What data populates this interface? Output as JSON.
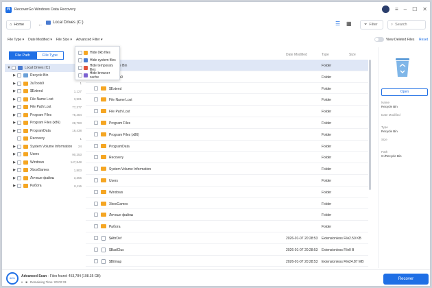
{
  "app": {
    "title": "RecoverGo Windows Data Recovery",
    "logo": "R"
  },
  "window_controls": {
    "settings": "≡",
    "minimize": "–",
    "maximize": "☐",
    "close": "✕"
  },
  "nav": {
    "home_label": "Home",
    "breadcrumb": "Local Drives (C:)",
    "filter_label": "Filter",
    "search_placeholder": "Search"
  },
  "filter_bar": {
    "file_type": "File Type",
    "date_modified": "Date Modified",
    "file_size": "File Size",
    "advanced_filter": "Advanced Filter",
    "view_deleted": "View Deleted Files",
    "reset": "Reset"
  },
  "advanced_menu": [
    {
      "label": "Hide 0kb files",
      "icon_color": "#f5a623"
    },
    {
      "label": "Hide system files",
      "icon_color": "#4a7bd0"
    },
    {
      "label": "Hide temporary files",
      "icon_color": "#e0533d"
    },
    {
      "label": "Hide browser cache",
      "icon_color": "#7b61d1"
    }
  ],
  "left_tabs": {
    "file_path": "File Path",
    "file_type": "File Type"
  },
  "tree": [
    {
      "label": "Local Drives (C:)",
      "count": "453,",
      "icon": "drive",
      "caret": "▼",
      "selected": true
    },
    {
      "label": "Recycle Bin",
      "count": "",
      "icon": "bin",
      "caret": "▶"
    },
    {
      "label": "3uTools9",
      "count": "1",
      "icon": "folder",
      "caret": "▶"
    },
    {
      "label": "$Extend",
      "count": "1,127",
      "icon": "folder",
      "caret": "▶"
    },
    {
      "label": "File Name Lost",
      "count": "3,901",
      "icon": "folder",
      "caret": "▶"
    },
    {
      "label": "File Path Lost",
      "count": "77,377",
      "icon": "folder",
      "caret": "▶"
    },
    {
      "label": "Program Files",
      "count": "75,484",
      "icon": "folder",
      "caret": "▶"
    },
    {
      "label": "Program Files (x86)",
      "count": "28,783",
      "icon": "folder",
      "caret": "▶"
    },
    {
      "label": "ProgramData",
      "count": "16,438",
      "icon": "folder",
      "caret": "▶"
    },
    {
      "label": "Recovery",
      "count": "1",
      "icon": "folder",
      "caret": ""
    },
    {
      "label": "System Volume Information",
      "count": "24",
      "icon": "folder",
      "caret": "▶"
    },
    {
      "label": "Users",
      "count": "90,253",
      "icon": "folder",
      "caret": "▶"
    },
    {
      "label": "Windows",
      "count": "147,848",
      "icon": "folder",
      "caret": "▶"
    },
    {
      "label": "XboxGames",
      "count": "1,803",
      "icon": "folder",
      "caret": "▶"
    },
    {
      "label": "Личные файлы",
      "count": "3,356",
      "icon": "folder",
      "caret": "▶"
    },
    {
      "label": "Работа",
      "count": "8,116",
      "icon": "folder",
      "caret": "▶"
    }
  ],
  "columns": {
    "date_modified": "Date Modified",
    "type": "Type",
    "size": "Size"
  },
  "rows": [
    {
      "name": "Recycle Bin",
      "date": "",
      "type": "Folder",
      "size": "",
      "icon": "bin",
      "selected": true
    },
    {
      "name": "3uTools9",
      "date": "",
      "type": "Folder",
      "size": "",
      "icon": "folder"
    },
    {
      "name": "$Extend",
      "date": "",
      "type": "Folder",
      "size": "",
      "icon": "folder"
    },
    {
      "name": "File Name Lost",
      "date": "",
      "type": "Folder",
      "size": "",
      "icon": "folder"
    },
    {
      "name": "File Path Lost",
      "date": "",
      "type": "Folder",
      "size": "",
      "icon": "folder"
    },
    {
      "name": "Program Files",
      "date": "",
      "type": "Folder",
      "size": "",
      "icon": "folder"
    },
    {
      "name": "Program Files (x86)",
      "date": "",
      "type": "Folder",
      "size": "",
      "icon": "folder"
    },
    {
      "name": "ProgramData",
      "date": "",
      "type": "Folder",
      "size": "",
      "icon": "folder"
    },
    {
      "name": "Recovery",
      "date": "",
      "type": "Folder",
      "size": "",
      "icon": "folder"
    },
    {
      "name": "System Volume Information",
      "date": "",
      "type": "Folder",
      "size": "",
      "icon": "folder"
    },
    {
      "name": "Users",
      "date": "",
      "type": "Folder",
      "size": "",
      "icon": "folder"
    },
    {
      "name": "Windows",
      "date": "",
      "type": "Folder",
      "size": "",
      "icon": "folder"
    },
    {
      "name": "XboxGames",
      "date": "",
      "type": "Folder",
      "size": "",
      "icon": "folder"
    },
    {
      "name": "Личные файлы",
      "date": "",
      "type": "Folder",
      "size": "",
      "icon": "folder"
    },
    {
      "name": "Работа",
      "date": "",
      "type": "Folder",
      "size": "",
      "icon": "folder"
    },
    {
      "name": "$AttrDef",
      "date": "2026-01-07 20:28:53",
      "type": "Extensionless File",
      "size": "2.50 KB",
      "icon": "file"
    },
    {
      "name": "$BadClus",
      "date": "2026-01-07 20:28:53",
      "type": "Extensionless File",
      "size": "0 B",
      "icon": "file"
    },
    {
      "name": "$Bitmap",
      "date": "2026-01-07 20:28:53",
      "type": "Extensionless File",
      "size": "24.87 MB",
      "icon": "file"
    }
  ],
  "details": {
    "open_label": "Open",
    "name_key": "Name",
    "name_val": "Recycle Bin",
    "date_key": "Date Modified",
    "date_val": "",
    "type_key": "Type",
    "type_val": "Recycle Bin",
    "size_key": "Size",
    "size_val": "",
    "path_key": "Path",
    "path_val": "C:/Recycle Bin"
  },
  "footer": {
    "percent": "66%",
    "scan_title": "Advanced Scan",
    "files_found": " - Files found: 453,784 (108.35 GB)",
    "remaining": "Remaining Time: 00:02:33",
    "recover_label": "Recover"
  },
  "colors": {
    "accent": "#1f6fe5",
    "folder": "#f5a623"
  }
}
